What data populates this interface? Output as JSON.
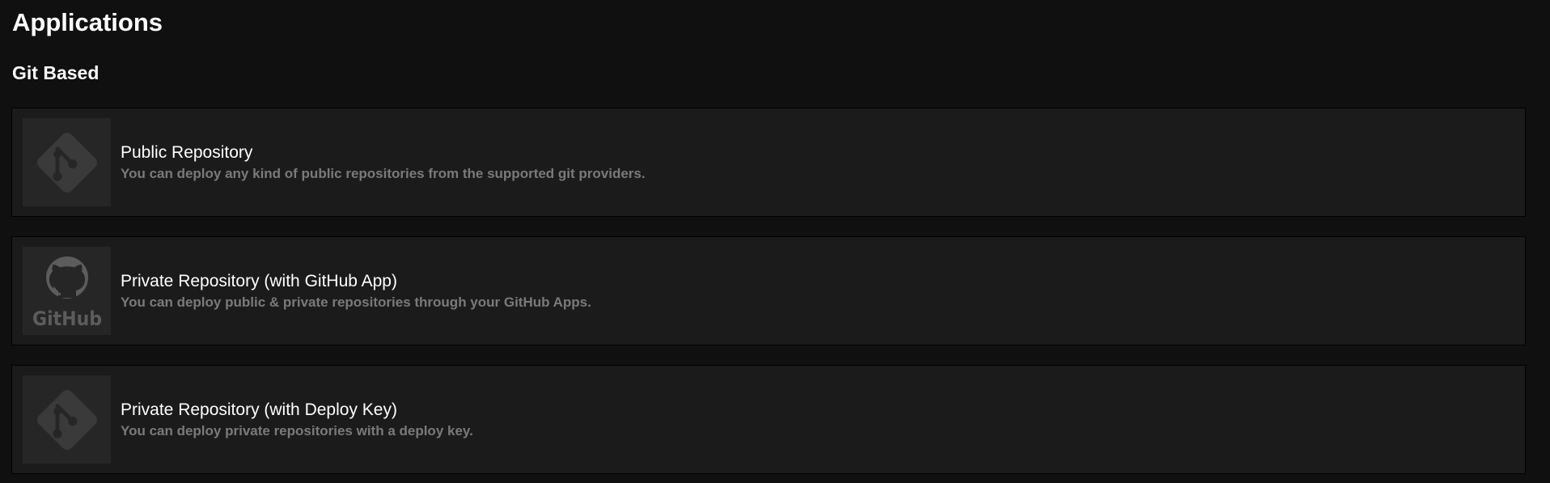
{
  "page": {
    "title": "Applications"
  },
  "sections": [
    {
      "title": "Git Based",
      "cards": [
        {
          "icon": "git-icon",
          "title": "Public Repository",
          "description": "You can deploy any kind of public repositories from the supported git providers."
        },
        {
          "icon": "github-icon",
          "title": "Private Repository (with GitHub App)",
          "description": "You can deploy public & private repositories through your GitHub Apps."
        },
        {
          "icon": "git-icon",
          "title": "Private Repository (with Deploy Key)",
          "description": "You can deploy private repositories with a deploy key."
        }
      ]
    }
  ],
  "icon_label": {
    "github_wordmark": "GitHub"
  },
  "colors": {
    "background": "#101010",
    "card_background": "#1b1b1b",
    "icon_background": "#262626",
    "icon_foreground": "#3a3a3a",
    "github_icon_foreground": "#5c5c5c",
    "description_text": "#7a7a7a"
  }
}
